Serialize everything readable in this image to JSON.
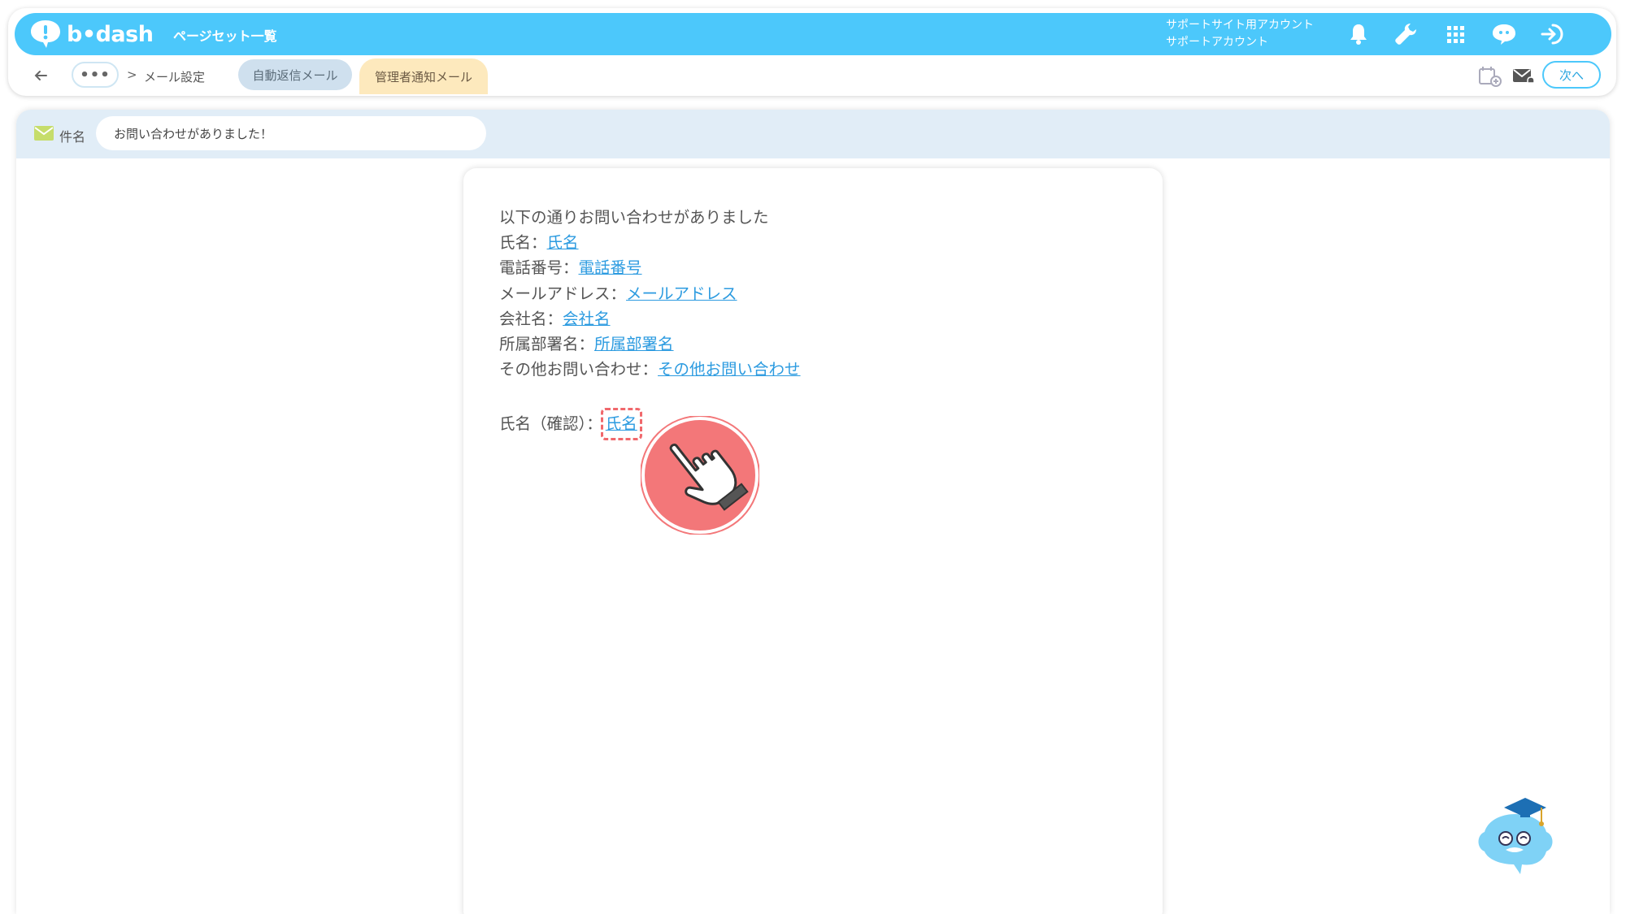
{
  "header": {
    "logo_text": "b•dash",
    "nav_title": "ページセット一覧",
    "account_line1": "サポートサイト用アカウント",
    "account_line2": "サポートアカウント",
    "icons": [
      "bell-icon",
      "wrench-icon",
      "grid-icon",
      "chat-bot-icon",
      "logout-icon"
    ],
    "accent_color": "#4cc8fb"
  },
  "breadcrumb": {
    "more": "•••",
    "separator": ">",
    "current": "メール設定"
  },
  "tabs": [
    {
      "label": "自動返信メール",
      "active": false
    },
    {
      "label": "管理者通知メール",
      "active": true
    }
  ],
  "toolbar": {
    "next_label": "次へ",
    "icons": [
      "calendar-check-icon",
      "mail-notify-icon"
    ]
  },
  "subject": {
    "label": "件名",
    "value": "お問い合わせがありました！"
  },
  "mail_body": {
    "intro": "以下の通りお問い合わせがありました",
    "fields": [
      {
        "label": "氏名：",
        "var": "氏名"
      },
      {
        "label": "電話番号：",
        "var": "電話番号"
      },
      {
        "label": "メールアドレス：",
        "var": "メールアドレス"
      },
      {
        "label": "会社名：",
        "var": "会社名"
      },
      {
        "label": "所属部署名：",
        "var": "所属部署名"
      },
      {
        "label": "その他お問い合わせ：",
        "var": "その他お問い合わせ"
      }
    ],
    "confirm": {
      "label": "氏名（確認）：",
      "var": "氏名"
    }
  }
}
